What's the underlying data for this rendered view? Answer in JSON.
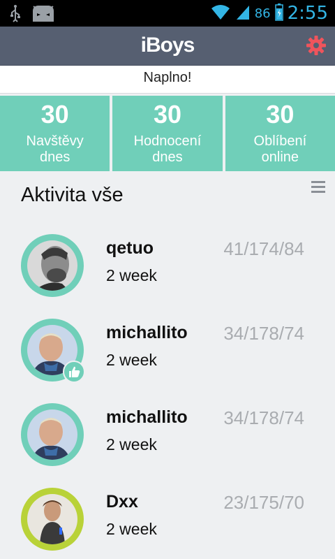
{
  "status_bar": {
    "battery": "86",
    "time": "2:55",
    "icons": [
      "usb-icon",
      "android-debug-icon",
      "wifi-icon",
      "signal-icon",
      "battery-icon"
    ]
  },
  "header": {
    "title": "iBoys",
    "settings_icon": "gear-icon",
    "accent": "#f0545c"
  },
  "banner": {
    "text": "Naplno!"
  },
  "stats": [
    {
      "value": "30",
      "label_line1": "Navštěvy",
      "label_line2": "dnes"
    },
    {
      "value": "30",
      "label_line1": "Hodnocení",
      "label_line2": "dnes"
    },
    {
      "value": "30",
      "label_line1": "Oblíbení",
      "label_line2": "online"
    }
  ],
  "activity": {
    "title": "Aktivita vše",
    "menu_icon": "menu-icon",
    "items": [
      {
        "name": "qetuo",
        "time": "2 week",
        "stats": "41/174/84",
        "ring": "#70cfb9",
        "badge": false
      },
      {
        "name": "michallito",
        "time": "2 week",
        "stats": "34/178/74",
        "ring": "#70cfb9",
        "badge": true
      },
      {
        "name": "michallito",
        "time": "2 week",
        "stats": "34/178/74",
        "ring": "#70cfb9",
        "badge": false
      },
      {
        "name": "Dxx",
        "time": "2 week",
        "stats": "23/175/70",
        "ring": "#b9d238",
        "badge": false
      }
    ]
  },
  "colors": {
    "header_bg": "#565f71",
    "stat_bg": "#70cfb9",
    "status_blue": "#33b5e5"
  }
}
